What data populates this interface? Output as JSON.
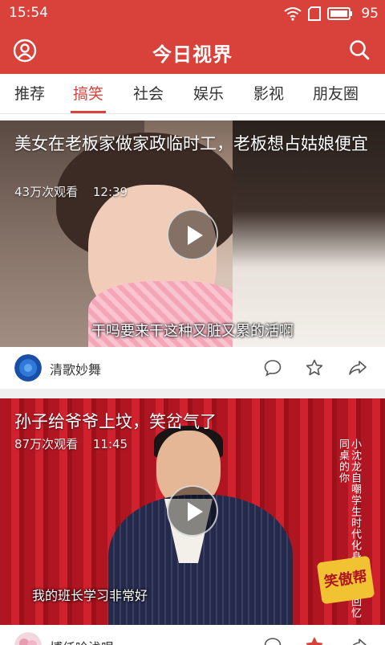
{
  "status_bar": {
    "time": "15:54",
    "battery": "95"
  },
  "header": {
    "title": "今日视界"
  },
  "tabs": [
    {
      "label": "推荐"
    },
    {
      "label": "搞笑",
      "active": true
    },
    {
      "label": "社会"
    },
    {
      "label": "娱乐"
    },
    {
      "label": "影视"
    },
    {
      "label": "朋友圈"
    }
  ],
  "feed": [
    {
      "title": "美女在老板家做家政临时工，老板想占姑娘便宜",
      "views": "43万次观看",
      "duration": "12:39",
      "subtitle": "干吗要来干这种又脏又累的活啊",
      "author": "清歌妙舞",
      "favorited": false
    },
    {
      "title": "孙子给爷爷上坟，笑岔气了",
      "views": "87万次观看",
      "duration": "11:45",
      "subtitle": "我的班长学习非常好",
      "side_text": "小沈龙自嘲学生时代化身高晓松回忆同桌的你",
      "show_logo": "笑傲帮",
      "author": "博仟吟浅唱",
      "favorited": true
    }
  ],
  "colors": {
    "brand_red": "#d8423a",
    "tab_text": "#333333",
    "divider_gray": "#f0f0f0"
  },
  "icons": [
    "wifi-icon",
    "sim-card-icon",
    "battery-icon",
    "user-profile-icon",
    "search-icon",
    "play-icon",
    "comment-icon",
    "star-icon",
    "share-icon"
  ]
}
